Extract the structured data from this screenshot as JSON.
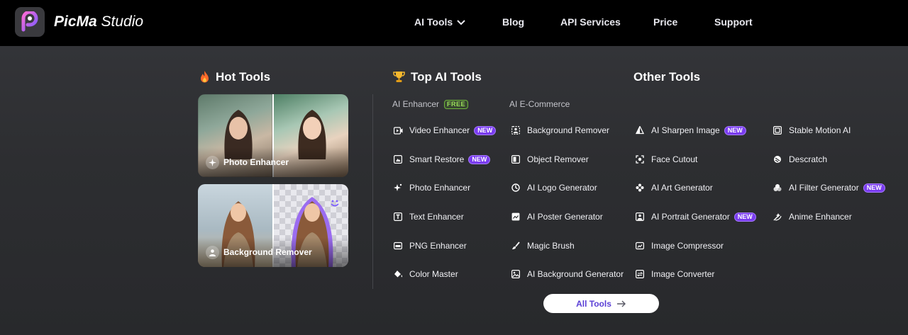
{
  "brand": {
    "name_bold": "PicMa",
    "name_light": " Studio"
  },
  "nav": [
    {
      "label": "AI Tools",
      "has_dropdown": true
    },
    {
      "label": "Blog"
    },
    {
      "label": "API Services"
    },
    {
      "label": "Price"
    },
    {
      "label": "Support"
    }
  ],
  "sections": {
    "hot": {
      "title": "Hot Tools",
      "icon": "fire-icon"
    },
    "top": {
      "title": "Top AI Tools",
      "icon": "trophy-icon"
    },
    "other": {
      "title": "Other Tools"
    }
  },
  "hot_cards": [
    {
      "label": "Photo Enhancer",
      "icon": "sparkle-icon"
    },
    {
      "label": "Background Remover",
      "icon": "person-icon"
    }
  ],
  "subheads": {
    "enhancer": "AI Enhancer",
    "free_badge": "FREE",
    "ecommerce": "AI E-Commerce"
  },
  "badge_new": "NEW",
  "col_enhancer": [
    {
      "label": "Video Enhancer",
      "icon": "video-icon",
      "new": true
    },
    {
      "label": "Smart Restore",
      "icon": "restore-icon",
      "new": true
    },
    {
      "label": "Photo Enhancer",
      "icon": "sparkle-icon",
      "new": false
    },
    {
      "label": "Text Enhancer",
      "icon": "text-icon",
      "new": false
    },
    {
      "label": "PNG Enhancer",
      "icon": "png-icon",
      "new": false
    },
    {
      "label": "Color Master",
      "icon": "paint-bucket-icon",
      "new": false
    }
  ],
  "col_ecommerce": [
    {
      "label": "Background Remover",
      "icon": "person-frame-icon"
    },
    {
      "label": "Object Remover",
      "icon": "object-icon"
    },
    {
      "label": "AI Logo Generator",
      "icon": "logo-icon"
    },
    {
      "label": "AI Poster Generator",
      "icon": "poster-icon"
    },
    {
      "label": "Magic Brush",
      "icon": "brush-icon"
    },
    {
      "label": "AI Background Generator",
      "icon": "background-icon"
    }
  ],
  "col_other1": [
    {
      "label": "AI Sharpen Image",
      "icon": "sharpen-icon",
      "new": true
    },
    {
      "label": "Face Cutout",
      "icon": "face-icon",
      "new": false
    },
    {
      "label": "AI Art Generator",
      "icon": "art-icon",
      "new": false
    },
    {
      "label": "AI Portrait Generator",
      "icon": "portrait-icon",
      "new": true
    },
    {
      "label": "Image Compressor",
      "icon": "compress-icon",
      "new": false
    },
    {
      "label": "Image Converter",
      "icon": "convert-icon",
      "new": false
    }
  ],
  "col_other2": [
    {
      "label": "Stable Motion AI",
      "icon": "motion-icon",
      "new": false
    },
    {
      "label": "Descratch",
      "icon": "descratch-icon",
      "new": false
    },
    {
      "label": "AI Filter Generator",
      "icon": "filter-icon",
      "new": true
    },
    {
      "label": "Anime Enhancer",
      "icon": "anime-icon",
      "new": false
    }
  ],
  "all_tools": "All Tools",
  "colors": {
    "accent": "#7a3cf0",
    "button_text": "#5a3fd6",
    "free": "#9be05a"
  }
}
